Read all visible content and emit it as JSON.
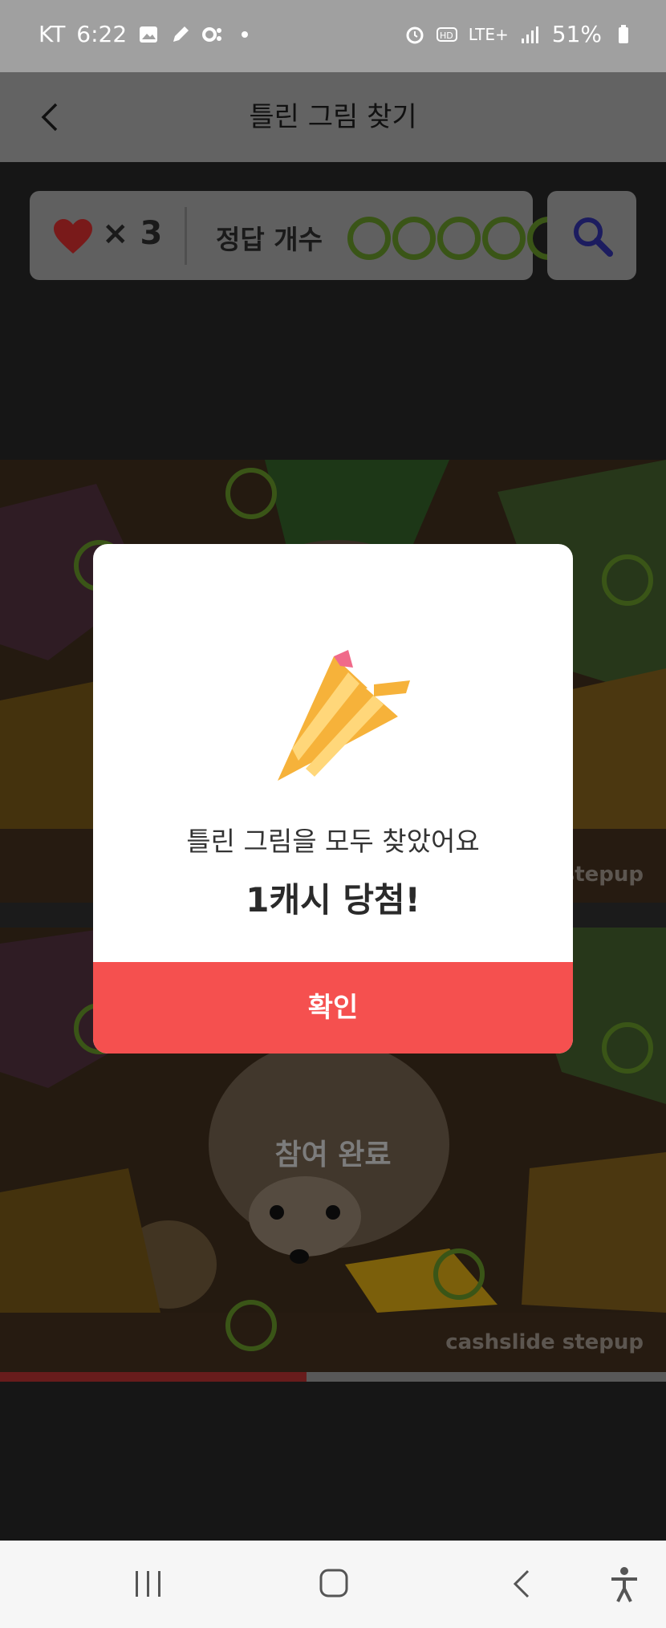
{
  "status_bar": {
    "carrier": "KT",
    "time": "6:22",
    "network": "LTE+",
    "battery": "51%"
  },
  "header": {
    "title": "틀린 그림 찾기"
  },
  "game_bar": {
    "lives": "× 3",
    "answer_label": "정답 개수",
    "answers_found": 5,
    "answers_total": 5
  },
  "images": {
    "watermark": "cashslide stepup",
    "participation_text": "참여 완료"
  },
  "progress": {
    "fraction": 0.46
  },
  "modal": {
    "message": "틀린 그림을 모두 찾았어요",
    "prize": "1캐시 당첨!",
    "confirm_label": "확인"
  },
  "colors": {
    "accent_red": "#f5504f",
    "circle_green": "#5e8a26",
    "heart_red": "#c42a2a",
    "search_blue": "#2e2e9a"
  },
  "icons": {
    "back": "chevron-left-icon",
    "heart": "heart-icon",
    "search": "magnifier-icon",
    "nav_recent": "recent-apps-icon",
    "nav_home": "home-icon",
    "nav_back": "back-icon",
    "nav_accessibility": "accessibility-icon"
  }
}
